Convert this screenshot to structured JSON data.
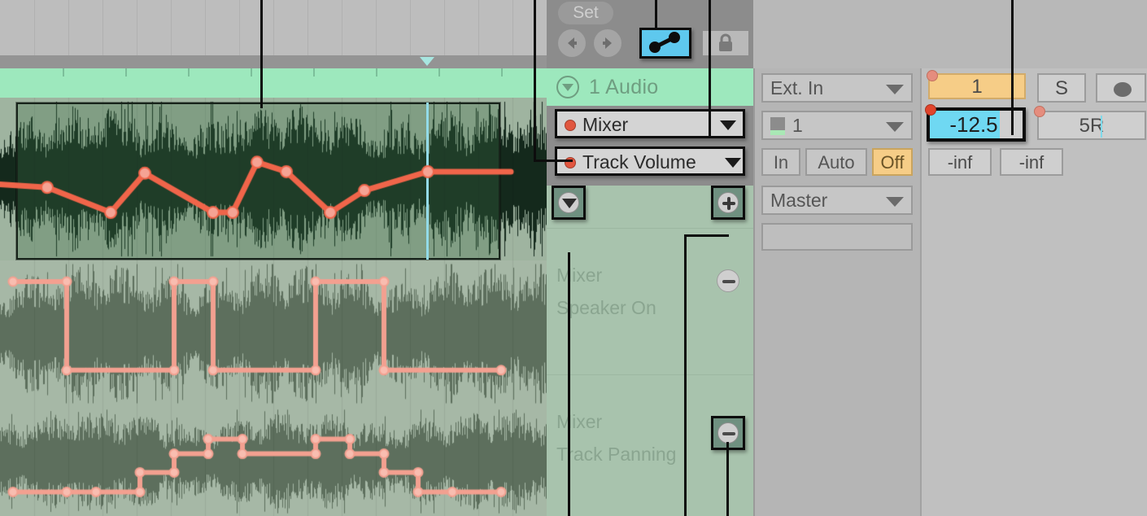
{
  "transport": {
    "set_label": "Set",
    "prev_icon": "arrow-left-icon",
    "next_icon": "arrow-right-icon",
    "automation_mode_icon": "automation-breakpoint-icon",
    "lock_icon": "lock-icon"
  },
  "track": {
    "name": "1 Audio",
    "fold_icon": "chevron-down-circle-icon",
    "device_chooser": {
      "label": "Mixer",
      "dot": "automation-red-dot"
    },
    "parameter_chooser": {
      "label": "Track Volume",
      "dot": "automation-red-dot"
    }
  },
  "envelope_lanes": {
    "show_lanes_icon": "caret-down-button",
    "add_lane_icon": "plus-button",
    "remove_lane_icon": "minus-button",
    "rows": [
      {
        "device": "Mixer",
        "parameter": "Speaker On",
        "remove_icon": "minus-button"
      },
      {
        "device": "Mixer",
        "parameter": "Track Panning",
        "remove_icon": "minus-button"
      }
    ]
  },
  "io": {
    "input_type": "Ext. In",
    "input_channel": "1",
    "monitor": {
      "in": "In",
      "auto": "Auto",
      "off": "Off",
      "selected": "Off"
    },
    "output_type": "Master",
    "output_channel": ""
  },
  "mixer": {
    "track_number": "1",
    "solo_label": "S",
    "arm_label": "record-arm-dot",
    "volume_value": "-12.5",
    "pan_value": "5R",
    "meter_left": "-inf",
    "meter_right": "-inf"
  },
  "chart_data": {
    "type": "line",
    "title": "Track Volume automation envelope",
    "lanes": [
      {
        "name": "Track Volume",
        "color": "#f0654a",
        "points": [
          [
            -0.03,
            0.48
          ],
          [
            0.07,
            0.46
          ],
          [
            0.2,
            0.3
          ],
          [
            0.27,
            0.55
          ],
          [
            0.41,
            0.3
          ],
          [
            0.45,
            0.3
          ],
          [
            0.5,
            0.62
          ],
          [
            0.56,
            0.56
          ],
          [
            0.65,
            0.3
          ],
          [
            0.72,
            0.44
          ],
          [
            0.85,
            0.56
          ],
          [
            1.02,
            0.56
          ]
        ]
      },
      {
        "name": "Speaker On",
        "color": "#f3a090",
        "shape": "step",
        "points": [
          [
            0.0,
            0.9
          ],
          [
            0.11,
            0.9
          ],
          [
            0.11,
            0.22
          ],
          [
            0.33,
            0.22
          ],
          [
            0.33,
            0.9
          ],
          [
            0.41,
            0.9
          ],
          [
            0.41,
            0.22
          ],
          [
            0.62,
            0.22
          ],
          [
            0.62,
            0.9
          ],
          [
            0.76,
            0.9
          ],
          [
            0.76,
            0.22
          ],
          [
            1.0,
            0.22
          ]
        ]
      },
      {
        "name": "Track Panning",
        "color": "#f3a090",
        "shape": "step",
        "points": [
          [
            0.0,
            0.18
          ],
          [
            0.11,
            0.18
          ],
          [
            0.17,
            0.18
          ],
          [
            0.26,
            0.18
          ],
          [
            0.26,
            0.38
          ],
          [
            0.33,
            0.38
          ],
          [
            0.33,
            0.57
          ],
          [
            0.4,
            0.57
          ],
          [
            0.4,
            0.72
          ],
          [
            0.47,
            0.72
          ],
          [
            0.47,
            0.57
          ],
          [
            0.62,
            0.57
          ],
          [
            0.62,
            0.72
          ],
          [
            0.69,
            0.72
          ],
          [
            0.69,
            0.57
          ],
          [
            0.76,
            0.57
          ],
          [
            0.76,
            0.38
          ],
          [
            0.83,
            0.38
          ],
          [
            0.83,
            0.18
          ],
          [
            0.9,
            0.18
          ],
          [
            1.0,
            0.18
          ]
        ]
      }
    ],
    "xlabel": "",
    "ylabel": "",
    "grid": true
  }
}
